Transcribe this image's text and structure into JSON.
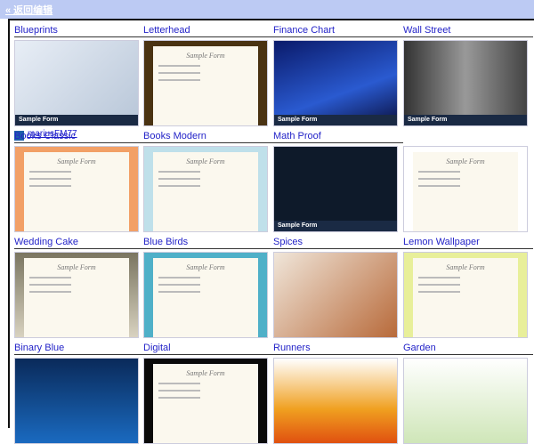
{
  "header": {
    "back_link": "« 返回编辑"
  },
  "templates": [
    {
      "name": "Blueprints",
      "bg": "linear-gradient(135deg,#e8eef6,#b8c6d8)",
      "caption": "Sample Form",
      "author": "mariusFM77"
    },
    {
      "name": "Letterhead",
      "bg": "#4a3312",
      "form": "Sample Form"
    },
    {
      "name": "Finance Chart",
      "bg": "linear-gradient(160deg,#0a1a6a,#2a5ad0 60%,#0a1040)",
      "caption": "Sample Form"
    },
    {
      "name": "Wall Street",
      "bg": "linear-gradient(90deg,#333,#999 50%,#444)",
      "caption": "Sample Form"
    },
    {
      "name": "Books Classic",
      "bg": "#f2a066",
      "form": "Sample Form"
    },
    {
      "name": "Books Modern",
      "bg": "#bfe0ea",
      "form": "Sample Form"
    },
    {
      "name": "Math Proof",
      "bg": "#0e1a2a",
      "caption": "Sample Form"
    },
    {
      "name": "",
      "bg": "#fff",
      "form": "Sample Form"
    },
    {
      "name": "Wedding Cake",
      "bg": "linear-gradient(180deg,#7a7560,#d8d2c0)",
      "form": "Sample Form"
    },
    {
      "name": "Blue Birds",
      "bg": "#4fb0c8",
      "form": "Sample Form"
    },
    {
      "name": "Spices",
      "bg": "linear-gradient(135deg,#f0e6da,#b86a3a)"
    },
    {
      "name": "Lemon Wallpaper",
      "bg": "#e8ef9a",
      "form": "Sample Form"
    },
    {
      "name": "Binary Blue",
      "bg": "linear-gradient(180deg,#0a2a5a,#1a6ac0)"
    },
    {
      "name": "Digital",
      "bg": "#0a0a0a",
      "form": "Sample Form"
    },
    {
      "name": "Runners",
      "bg": "linear-gradient(180deg,#fff,#f0a020 60%,#e05010)"
    },
    {
      "name": "Garden",
      "bg": "linear-gradient(180deg,#fff,#cfe6b8)"
    }
  ]
}
